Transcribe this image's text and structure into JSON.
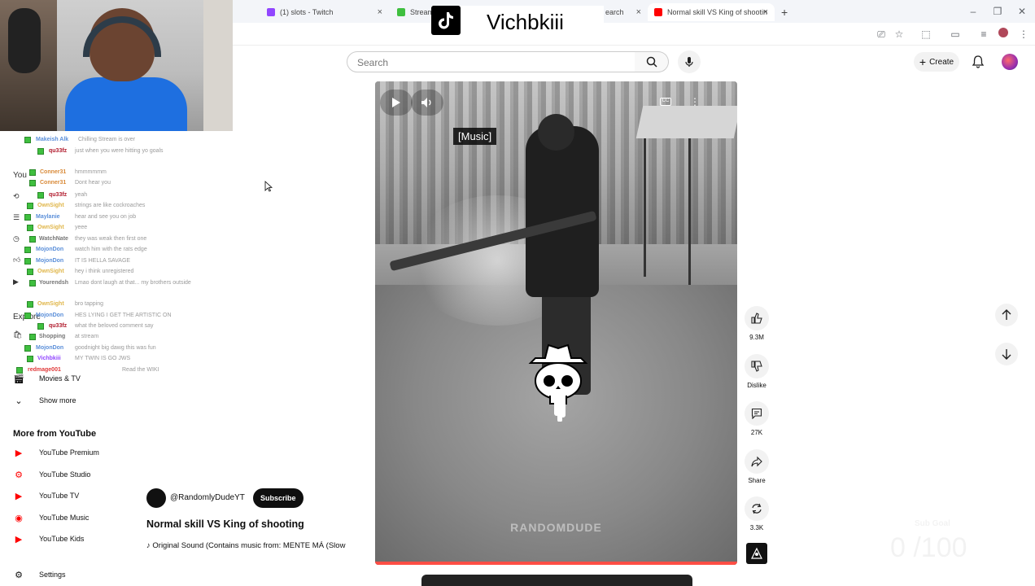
{
  "browser": {
    "tabs": [
      {
        "label": "(1) slots - Twitch",
        "favicon_color": "#9146ff"
      },
      {
        "label": "Stream",
        "favicon_color": "#3fbf3f"
      },
      {
        "label": "earch",
        "favicon_color": "#888888"
      },
      {
        "label": "Normal skill VS King of shootin",
        "favicon_color": "#ff0000"
      }
    ],
    "new_tab": "+"
  },
  "youtube": {
    "search_placeholder": "Search",
    "create_label": "Create"
  },
  "tiktok_overlay": {
    "username": "Vichbkiii"
  },
  "chat": [
    {
      "user": "Makeish Alk",
      "user_color": "#5b8fd9",
      "msg": "Chilling Stream is over"
    },
    {
      "user": "qu33fz",
      "user_color": "#b0192b",
      "msg": "just when you were hitting yo goals"
    },
    {
      "user": "Conner31",
      "user_color": "#d98b3a",
      "msg": "hmmmmmm"
    },
    {
      "user": "Conner31",
      "user_color": "#d98b3a",
      "msg": "Dont hear you"
    },
    {
      "user": "qu33fz",
      "user_color": "#b0192b",
      "msg": "yeah"
    },
    {
      "user": "OwnSight",
      "user_color": "#e0b64a",
      "msg": "strings are like cockroaches"
    },
    {
      "user": "Maylanie",
      "user_color": "#5b8fd9",
      "msg": "hear and see you on job"
    },
    {
      "user": "OwnSight",
      "user_color": "#e0b64a",
      "msg": "yeee"
    },
    {
      "user": "WatchNate",
      "user_color": "#777777",
      "msg": "they was weak then first one"
    },
    {
      "user": "MojonDon",
      "user_color": "#5b8fd9",
      "msg": "watch him with the rats edge"
    },
    {
      "user": "MojonDon",
      "user_color": "#5b8fd9",
      "msg": "IT IS HELLA SAVAGE"
    },
    {
      "user": "OwnSight",
      "user_color": "#e0b64a",
      "msg": "hey i think unregistered"
    },
    {
      "user": "Yourendsh",
      "user_color": "#777777",
      "msg": "Lmao dont laugh at that... my brothers outside"
    },
    {
      "user": "OwnSight",
      "user_color": "#e0b64a",
      "msg": "bro tapping"
    },
    {
      "user": "MojonDon",
      "user_color": "#5b8fd9",
      "msg": "HES LYING I GET THE ARTISTIC ON"
    },
    {
      "user": "qu33fz",
      "user_color": "#b0192b",
      "msg": "what the beloved comment say"
    },
    {
      "user": "Shopping",
      "user_color": "#777777",
      "msg": "at stream"
    },
    {
      "user": "MojonDon",
      "user_color": "#5b8fd9",
      "msg": "goodnight big dawg this was fun"
    },
    {
      "user": "Vichbkiii",
      "user_color": "#9146ff",
      "msg": "MY TWIN IS GO JWS"
    },
    {
      "user": "redmage001",
      "user_color": "#e03a3a",
      "msg": "Read the WIKI"
    }
  ],
  "sidebar": {
    "ghost_labels": [
      "You",
      "Explore"
    ],
    "movies_label": "Movies & TV",
    "show_more": "Show more",
    "more_from_youtube": "More from YouTube",
    "more_items": [
      {
        "label": "YouTube Premium",
        "icon": "yt-premium-icon",
        "color": "#ff0000"
      },
      {
        "label": "YouTube Studio",
        "icon": "yt-studio-icon",
        "color": "#ff0000"
      },
      {
        "label": "YouTube TV",
        "icon": "yt-tv-icon",
        "color": "#ff0000"
      },
      {
        "label": "YouTube Music",
        "icon": "yt-music-icon",
        "color": "#ff0000"
      },
      {
        "label": "YouTube Kids",
        "icon": "yt-kids-icon",
        "color": "#ff0000"
      }
    ],
    "settings": "Settings"
  },
  "player": {
    "caption": "[Music]",
    "watermark": "RANDOMDUDE",
    "progress": 1.0
  },
  "actions": {
    "like_count": "9.3M",
    "dislike_label": "Dislike",
    "comments_count": "27K",
    "share_label": "Share",
    "remix_count": "3.3K"
  },
  "video": {
    "channel": "@RandomlyDudeYT",
    "subscribe_label": "Subscribe",
    "title": "Normal skill VS King of shooting",
    "sound": "Original Sound (Contains music from: MENTE MÁ (Slow"
  },
  "stream_overlay": {
    "sub_goal": "Sub Goal",
    "sub_count": "0 /100"
  }
}
